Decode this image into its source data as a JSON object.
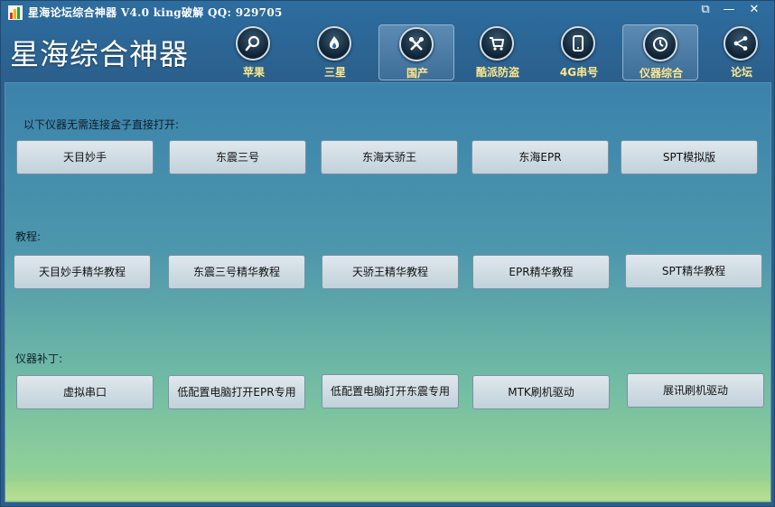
{
  "titlebar": {
    "title": "星海论坛综合神器 V4.0  king破解  QQ: 929705",
    "restore_symbol": "⧉",
    "minimize_symbol": "—",
    "close_symbol": "✕"
  },
  "brand": "星海综合神器",
  "nav": [
    {
      "label": "苹果",
      "icon": "search-icon"
    },
    {
      "label": "三星",
      "icon": "flame-icon"
    },
    {
      "label": "国产",
      "icon": "tools-icon",
      "active": true
    },
    {
      "label": "酷派防盗",
      "icon": "cart-icon"
    },
    {
      "label": "4G串号",
      "icon": "phone-icon"
    },
    {
      "label": "仪器综合",
      "icon": "dial-icon",
      "active": true
    },
    {
      "label": "论坛",
      "icon": "share-icon"
    }
  ],
  "sections": {
    "instruments_label": "以下仪器无需连接盒子直接打开:",
    "tutorials_label": "教程:",
    "patches_label": "仪器补丁:"
  },
  "instruments": [
    "天目妙手",
    "东震三号",
    "东海天骄王",
    "东海EPR",
    "SPT模拟版"
  ],
  "tutorials": [
    "天目妙手精华教程",
    "东震三号精华教程",
    "天骄王精华教程",
    "EPR精华教程",
    "SPT精华教程"
  ],
  "patches": [
    "虚拟串口",
    "低配置电脑打开EPR专用",
    "低配置电脑打开东震专用",
    "MTK刷机驱动",
    "展讯刷机驱动"
  ],
  "colors": {
    "nav_label": "#ffe88a",
    "title_text": "#ffffff"
  }
}
